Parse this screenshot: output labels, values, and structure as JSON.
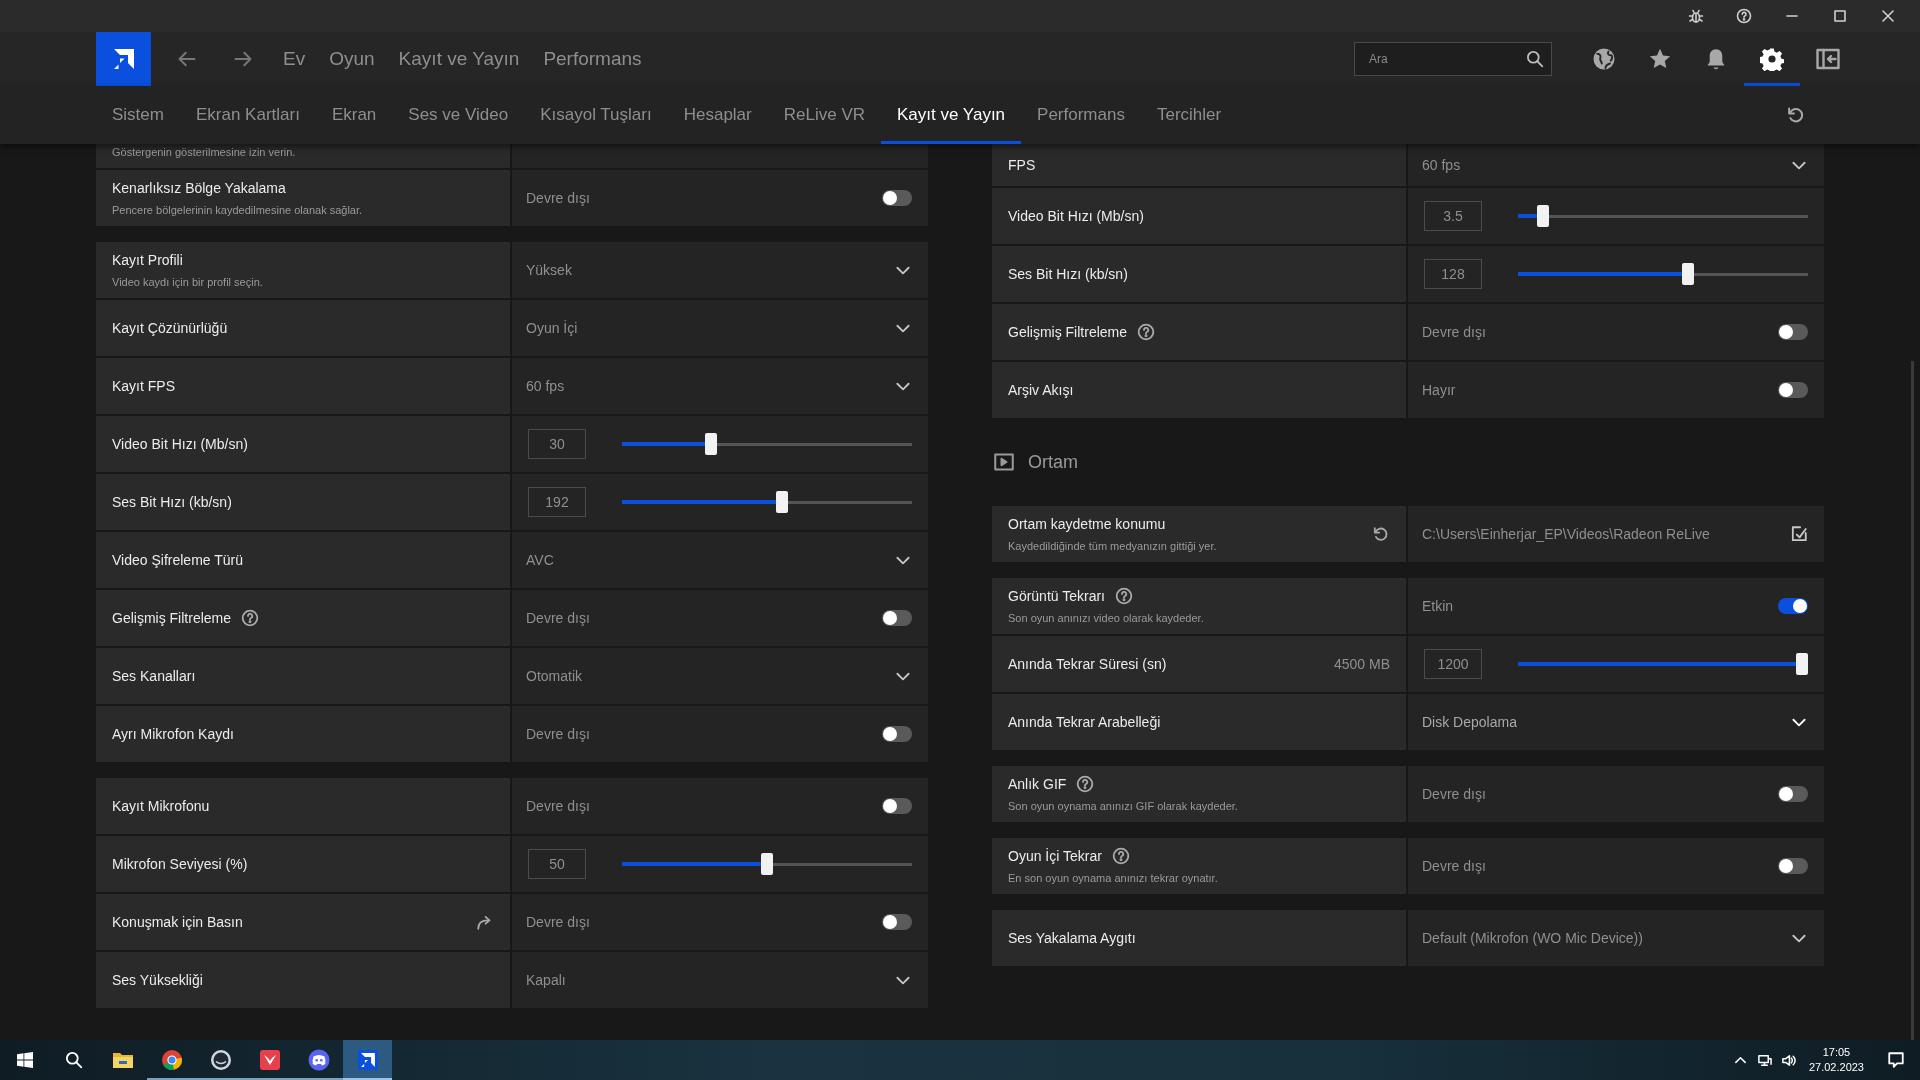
{
  "top_nav": {
    "items": [
      {
        "label": "Ev"
      },
      {
        "label": "Oyun"
      },
      {
        "label": "Kayıt ve Yayın"
      },
      {
        "label": "Performans"
      }
    ],
    "search": {
      "placeholder": "Ara"
    },
    "toolbar": [
      {
        "kind": "globe",
        "selected": false
      },
      {
        "kind": "star",
        "selected": false
      },
      {
        "kind": "bell",
        "selected": false
      },
      {
        "kind": "gear",
        "selected": true
      },
      {
        "kind": "panel",
        "selected": false
      }
    ]
  },
  "tabs": [
    {
      "label": "Sistem",
      "selected": false
    },
    {
      "label": "Ekran Kartları",
      "selected": false
    },
    {
      "label": "Ekran",
      "selected": false
    },
    {
      "label": "Ses ve Video",
      "selected": false
    },
    {
      "label": "Kısayol Tuşları",
      "selected": false
    },
    {
      "label": "Hesaplar",
      "selected": false
    },
    {
      "label": "ReLive VR",
      "selected": false
    },
    {
      "label": "Kayıt ve Yayın",
      "selected": true
    },
    {
      "label": "Performans",
      "selected": false
    },
    {
      "label": "Tercihler",
      "selected": false
    }
  ],
  "left_panel": {
    "blocks": [
      {
        "kind": "group",
        "rows": [
          {
            "kind": "partial",
            "description": "Göstergenin gösterilmesine izin verin."
          },
          {
            "kind": "toggle",
            "label": "Kenarlıksız Bölge Yakalama",
            "description": "Pencere bölgelerinin kaydedilmesine olanak sağlar.",
            "value": "Devre dışı",
            "on": false
          }
        ]
      },
      {
        "kind": "group",
        "rows": [
          {
            "kind": "dropdown",
            "label": "Kayıt Profili",
            "description": "Video kaydı için bir profil seçin.",
            "value": "Yüksek"
          },
          {
            "kind": "dropdown",
            "label": "Kayıt Çözünürlüğü",
            "value": "Oyun İçi"
          },
          {
            "kind": "dropdown",
            "label": "Kayıt FPS",
            "value": "60 fps"
          },
          {
            "kind": "slider",
            "label": "Video Bit Hızı (Mb/sn)",
            "value": "30",
            "level": 0.3
          },
          {
            "kind": "slider",
            "label": "Ses Bit Hızı (kb/sn)",
            "value": "192",
            "level": 0.555
          },
          {
            "kind": "dropdown",
            "label": "Video Şifreleme Türü",
            "value": "AVC"
          },
          {
            "kind": "toggle",
            "label": "Gelişmiş Filtreleme",
            "help": true,
            "value": "Devre dışı",
            "on": false
          },
          {
            "kind": "dropdown",
            "label": "Ses Kanalları",
            "value": "Otomatik"
          },
          {
            "kind": "toggle",
            "label": "Ayrı Mikrofon Kaydı",
            "value": "Devre dışı",
            "on": false
          }
        ]
      },
      {
        "kind": "group",
        "rows": [
          {
            "kind": "toggle",
            "label": "Kayıt Mikrofonu",
            "value": "Devre dışı",
            "on": false
          },
          {
            "kind": "slider",
            "label": "Mikrofon Seviyesi (%)",
            "value": "50",
            "level": 0.5
          },
          {
            "kind": "toggle",
            "label": "Konuşmak için Basın",
            "action": {
              "kind": "share"
            },
            "value": "Devre dışı",
            "on": false
          },
          {
            "kind": "dropdown",
            "label": "Ses Yüksekliği",
            "value": "Kapalı"
          }
        ]
      }
    ]
  },
  "right_panel": {
    "blocks": [
      {
        "kind": "group",
        "rows": [
          {
            "kind": "dropdown",
            "label": "FPS",
            "value": "60 fps"
          },
          {
            "kind": "slider",
            "label": "Video Bit Hızı (Mb/sn)",
            "value": "3.5",
            "level": 0.07
          },
          {
            "kind": "slider",
            "label": "Ses Bit Hızı (kb/sn)",
            "value": "128",
            "level": 0.59
          },
          {
            "kind": "toggle",
            "label": "Gelişmiş Filtreleme",
            "help": true,
            "value": "Devre dışı",
            "on": false
          },
          {
            "kind": "toggle",
            "label": "Arşiv Akışı",
            "value": "Hayır",
            "on": false
          }
        ]
      },
      {
        "kind": "heading",
        "title": "Ortam"
      },
      {
        "kind": "group",
        "rows": [
          {
            "kind": "path",
            "label": "Ortam kaydetme konumu",
            "description": "Kaydedildiğinde tüm medyanızın gittiği yer.",
            "action": {
              "kind": "reset"
            },
            "value": "C:\\Users\\Einherjar_EP\\Videos\\Radeon ReLive"
          }
        ]
      },
      {
        "kind": "group",
        "rows": [
          {
            "kind": "toggle",
            "label": "Görüntü Tekrarı",
            "help": true,
            "description": "Son oyun anınızı video olarak kaydeder.",
            "value": "Etkin",
            "on": true
          },
          {
            "kind": "slider",
            "label": "Anında Tekrar Süresi (sn)",
            "extra": "4500 MB",
            "value": "1200",
            "level": 1
          },
          {
            "kind": "dropdown",
            "label": "Anında Tekrar Arabelleği",
            "value": "Disk Depolama",
            "emphasis": true
          }
        ]
      },
      {
        "kind": "group",
        "rows": [
          {
            "kind": "toggle",
            "label": "Anlık GIF",
            "help": true,
            "description": "Son oyun oynama anınızı GIF olarak kaydeder.",
            "value": "Devre dışı",
            "on": false
          }
        ]
      },
      {
        "kind": "group",
        "rows": [
          {
            "kind": "toggle",
            "label": "Oyun İçi Tekrar",
            "help": true,
            "description": "En son oyun oynama anınızı tekrar oynatır.",
            "value": "Devre dışı",
            "on": false
          }
        ]
      },
      {
        "kind": "group",
        "rows": [
          {
            "kind": "dropdown",
            "label": "Ses Yakalama Aygıtı",
            "value": "Default (Mikrofon (WO Mic Device))"
          }
        ]
      }
    ]
  },
  "taskbar": {
    "apps": [
      {
        "kind": "explorer",
        "running": false,
        "selected": false
      },
      {
        "kind": "browser",
        "running": true,
        "selected": false
      },
      {
        "kind": "circle",
        "running": true,
        "selected": false
      },
      {
        "kind": "red",
        "running": true,
        "selected": false
      },
      {
        "kind": "chat",
        "running": true,
        "selected": false
      },
      {
        "kind": "amd",
        "running": true,
        "selected": true
      }
    ],
    "time": "17:05",
    "date": "27.02.2023"
  }
}
